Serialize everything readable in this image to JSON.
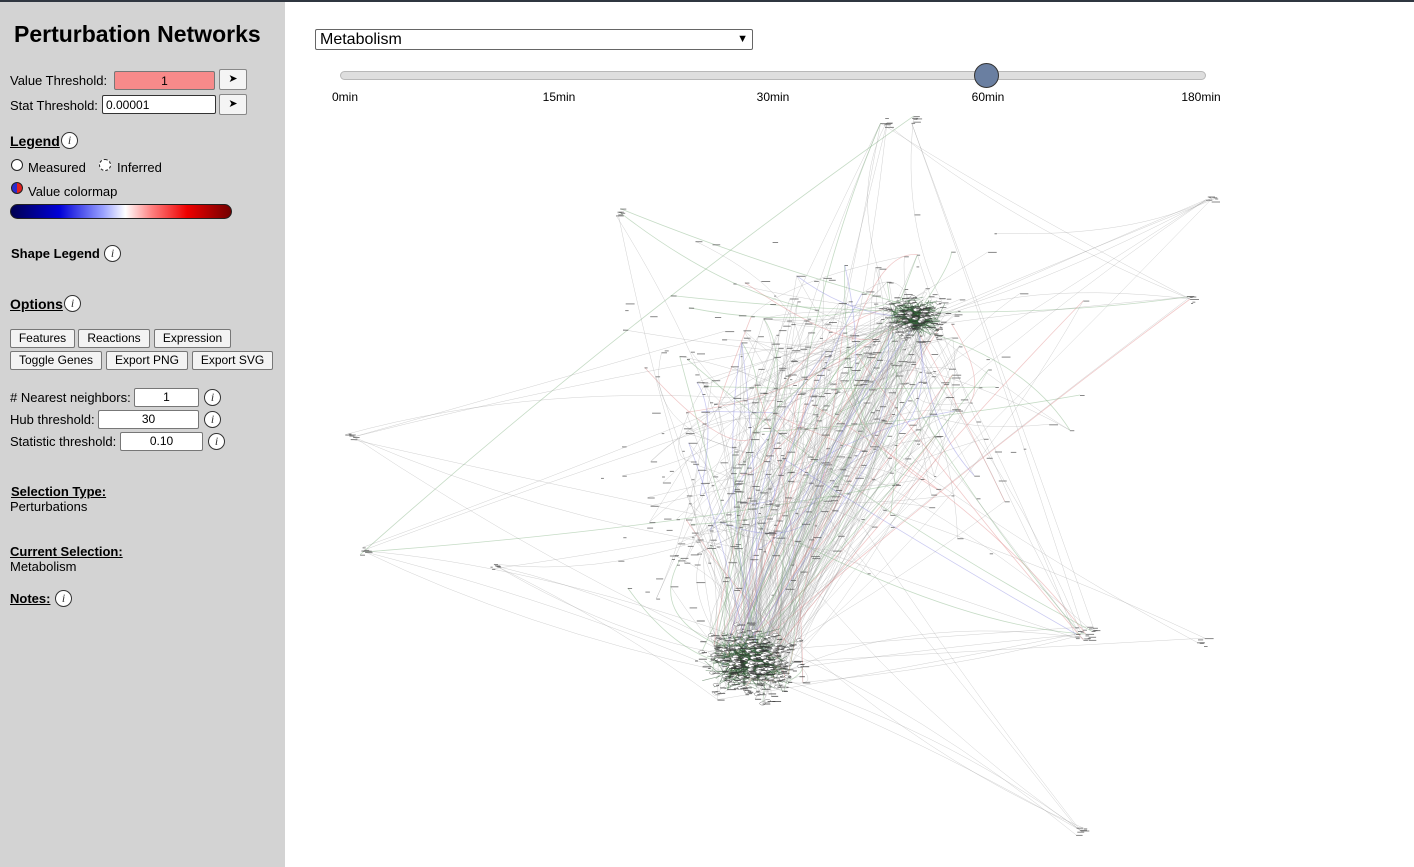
{
  "sidebar": {
    "title": "Perturbation Networks",
    "value_threshold": {
      "label": "Value Threshold:",
      "value": "1",
      "button": "➤"
    },
    "stat_threshold": {
      "label": "Stat Threshold:",
      "value": "0.00001",
      "button": "➤"
    },
    "legend": {
      "title": "Legend",
      "info": "i",
      "measured": "Measured",
      "inferred": "Inferred",
      "colormap_label": "Value colormap"
    },
    "shape_legend": {
      "title": "Shape Legend",
      "info": "i"
    },
    "options": {
      "title": "Options",
      "info": "i",
      "buttons": [
        "Features",
        "Reactions",
        "Expression",
        "Toggle Genes",
        "Export PNG",
        "Export SVG"
      ]
    },
    "params": [
      {
        "label": "# Nearest neighbors:",
        "value": "1",
        "info": "i"
      },
      {
        "label": "Hub threshold:",
        "value": "30",
        "info": "i"
      },
      {
        "label": "Statistic threshold:",
        "value": "0.10",
        "info": "i"
      }
    ],
    "selection_type": {
      "label": "Selection Type:",
      "value": "Perturbations"
    },
    "current_selection": {
      "label": "Current Selection:",
      "value": "Metabolism"
    },
    "notes": {
      "label": "Notes:",
      "info": "i"
    }
  },
  "main": {
    "dropdown": {
      "selected": "Metabolism"
    },
    "timepoint_slider": {
      "ticks": [
        "0min",
        "15min",
        "30min",
        "60min",
        "180min"
      ],
      "selected": "60min"
    }
  },
  "colors": {
    "sidebar_bg": "#d3d3d3",
    "value_input_bg": "#f78a8a",
    "slider_thumb": "#6a7fa1",
    "dense_cluster": "#2f5a34",
    "edge_green": "#7fb07f",
    "edge_red": "#e08a8a",
    "edge_blue": "#8a8ae0"
  }
}
